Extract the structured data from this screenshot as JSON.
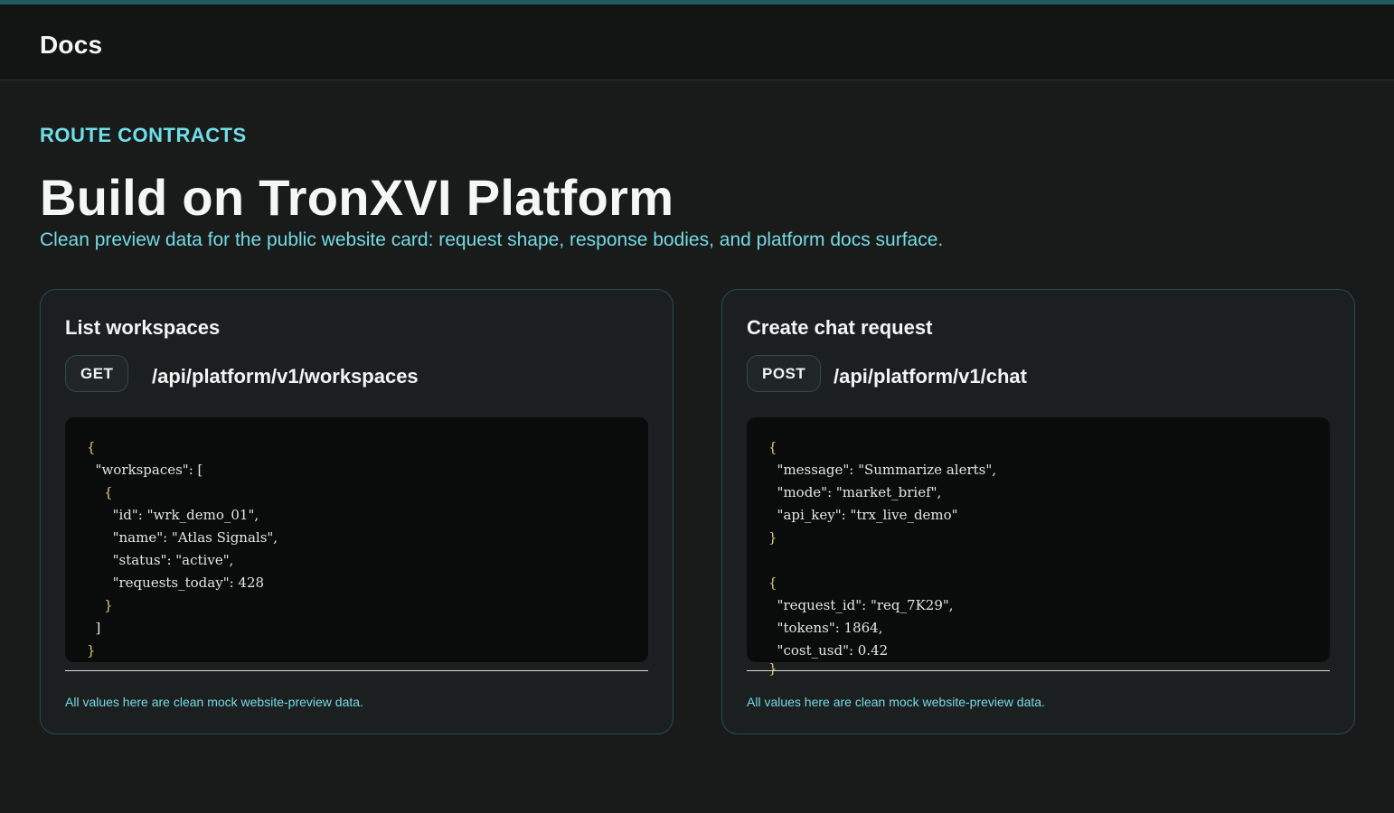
{
  "header": {
    "brand": "Docs"
  },
  "hero": {
    "eyebrow": "ROUTE CONTRACTS",
    "title": "Build on TronXVI Platform",
    "subtitle": "Clean preview data for the public website card: request shape, response bodies, and platform docs surface."
  },
  "cards": [
    {
      "title": "List workspaces",
      "method": "GET",
      "path": "/api/platform/v1/workspaces",
      "code_lines": [
        "\"workspaces\": [",
        "{",
        "\"id\": \"wrk_demo_01\",",
        "\"name\": \"Atlas Signals\",",
        "\"status\": \"active\",",
        "\"requests_today\": 428",
        "}",
        "]"
      ],
      "note": "All values here are clean mock website-preview data."
    },
    {
      "title": "Create chat request",
      "method": "POST",
      "path": "/api/platform/v1/chat",
      "code_lines": [
        "\"message\": \"Summarize alerts\",",
        "\"mode\": \"market_brief\",",
        "\"api_key\": \"trx_live_demo\"",
        "\"request_id\": \"req_7K29\",",
        "\"tokens\": 1864,",
        "\"cost_usd\": 0.42"
      ],
      "note": "All values here are clean mock website-preview data."
    }
  ],
  "colors": {
    "accent": "#6fdfe8",
    "background": "#191b1b",
    "code_brace": "#e5c77a"
  }
}
